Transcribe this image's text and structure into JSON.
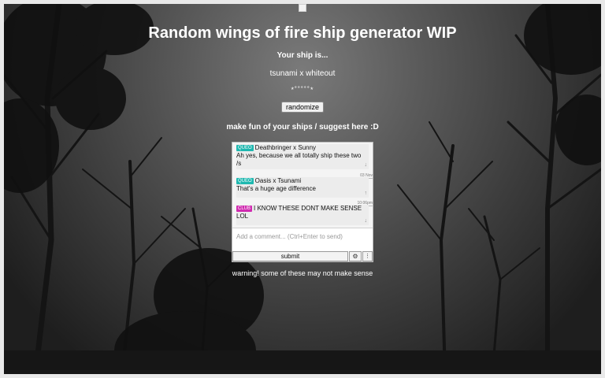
{
  "page": {
    "title": "Random wings of fire ship generator WIP",
    "ship_heading": "Your ship is...",
    "ship_pair": "tsunami x whiteout",
    "ship_symbols": "*˚˚˚˚˚*",
    "randomize_label": "randomize",
    "suggest_heading": "make fun of your ships / suggest here :D",
    "warning": "warning! some of these may not make sense"
  },
  "comment_widget": {
    "comments": [
      {
        "tag": "QUEO",
        "tag_color": "#1fb8b0",
        "title": "Deathbringer x Sunny",
        "body": "Ah yes, because we all totally ship these two /s",
        "date": "03 Nov",
        "meta": "↓"
      },
      {
        "tag": "QUEO",
        "tag_color": "#1fb8b0",
        "title": "Oasis x Tsunami",
        "body": "That's a huge age difference",
        "date": "10:06pm",
        "meta": "↑"
      },
      {
        "tag": "CLUB",
        "tag_color": "#d02bb0",
        "title": "I KNOW THESE DONT MAKE SENSE LOL",
        "body": "",
        "date": "",
        "meta": "↓"
      }
    ],
    "input_placeholder": "Add a comment... (Ctrl+Enter to send)",
    "submit_label": "submit",
    "settings_icon": "⚙",
    "more_icon": "⋮"
  },
  "colors": {
    "text": "#ffffff",
    "accent_teal": "#1fb8b0",
    "accent_magenta": "#d02bb0"
  }
}
